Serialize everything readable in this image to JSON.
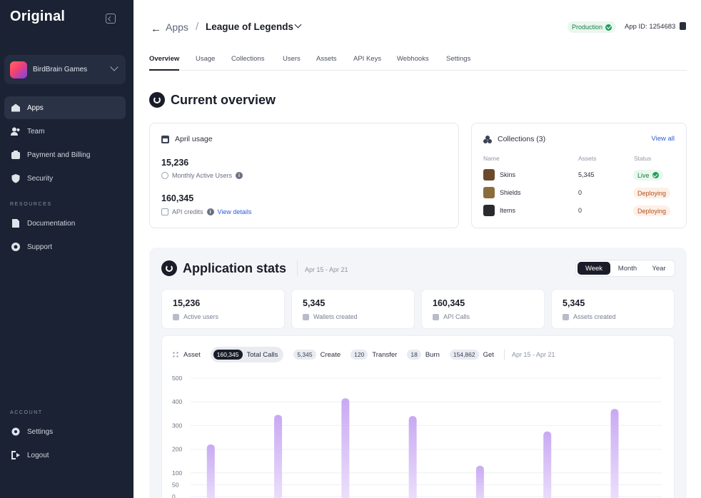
{
  "sidebar": {
    "logo": "Original",
    "org_name": "BirdBrain Games",
    "nav": [
      {
        "label": "Apps",
        "icon": "apps-icon",
        "active": true
      },
      {
        "label": "Team",
        "icon": "team-icon"
      },
      {
        "label": "Payment and Billing",
        "icon": "billing-icon"
      },
      {
        "label": "Security",
        "icon": "shield-icon"
      }
    ],
    "resources_label": "RESOURCES",
    "resources": [
      {
        "label": "Documentation",
        "icon": "documentation-icon"
      },
      {
        "label": "Support",
        "icon": "support-icon"
      }
    ],
    "account_label": "ACCOUNT",
    "account": [
      {
        "label": "Settings",
        "icon": "gear-icon"
      },
      {
        "label": "Logout",
        "icon": "logout-icon"
      }
    ]
  },
  "header": {
    "breadcrumb_root": "Apps",
    "breadcrumb_sep": "/",
    "current_app": "League of Legends",
    "environment": "Production",
    "app_id": "App ID: 1254683"
  },
  "tabs": [
    "Overview",
    "Usage",
    "Collections",
    "Users",
    "Assets",
    "API Keys",
    "Webhooks",
    "Settings"
  ],
  "overview": {
    "title": "Current overview",
    "usage": {
      "title": "April usage",
      "mau_value": "15,236",
      "mau_label": "Monthly Active Users",
      "credits_value": "160,345",
      "credits_label": "API credits",
      "details_link": "View details"
    },
    "collections": {
      "title": "Collections (3)",
      "view_all": "View all",
      "headers": [
        "Name",
        "Assets",
        "Status"
      ],
      "rows": [
        {
          "name": "Skins",
          "assets": "5,345",
          "status": "Live",
          "status_type": "live",
          "thumb": "#6b4a2b"
        },
        {
          "name": "Shields",
          "assets": "0",
          "status": "Deploying",
          "status_type": "deploying",
          "thumb": "#8a6d3b"
        },
        {
          "name": "Items",
          "assets": "0",
          "status": "Deploying",
          "status_type": "deploying",
          "thumb": "#2b2b2f"
        }
      ]
    }
  },
  "stats": {
    "title": "Application stats",
    "date_range": "Apr 15 - Apr 21",
    "periods": [
      "Week",
      "Month",
      "Year"
    ],
    "active_period": "Week",
    "cards": [
      {
        "value": "15,236",
        "label": "Active users"
      },
      {
        "value": "5,345",
        "label": "Wallets created"
      },
      {
        "value": "160,345",
        "label": "API Calls"
      },
      {
        "value": "5,345",
        "label": "Assets created"
      }
    ],
    "filter_asset": "Asset",
    "filters": [
      {
        "count": "160,345",
        "label": "Total Calls",
        "active": true
      },
      {
        "count": "5,345",
        "label": "Create"
      },
      {
        "count": "120",
        "label": "Transfer"
      },
      {
        "count": "18",
        "label": "Burn"
      },
      {
        "count": "154,862",
        "label": "Get"
      }
    ],
    "filter_range": "Apr 15 - Apr 21"
  },
  "chart_data": {
    "type": "bar",
    "title": "",
    "xlabel": "",
    "ylabel": "",
    "ylim": [
      0,
      500
    ],
    "yticks": [
      0,
      50,
      100,
      150,
      200,
      250,
      300,
      350,
      400,
      450,
      500
    ],
    "ytick_labels_shown": [
      "500",
      "400",
      "300",
      "200",
      "100",
      "50",
      "0"
    ],
    "values": [
      220,
      345,
      415,
      340,
      130,
      275,
      370
    ],
    "bar_color": "#cdb2f2",
    "grid": true
  },
  "colors": {
    "sidebar_bg": "#1b2233",
    "accent_link": "#2d5bd6",
    "live_green": "#1f9d57",
    "deploying_orange": "#b4531c"
  }
}
